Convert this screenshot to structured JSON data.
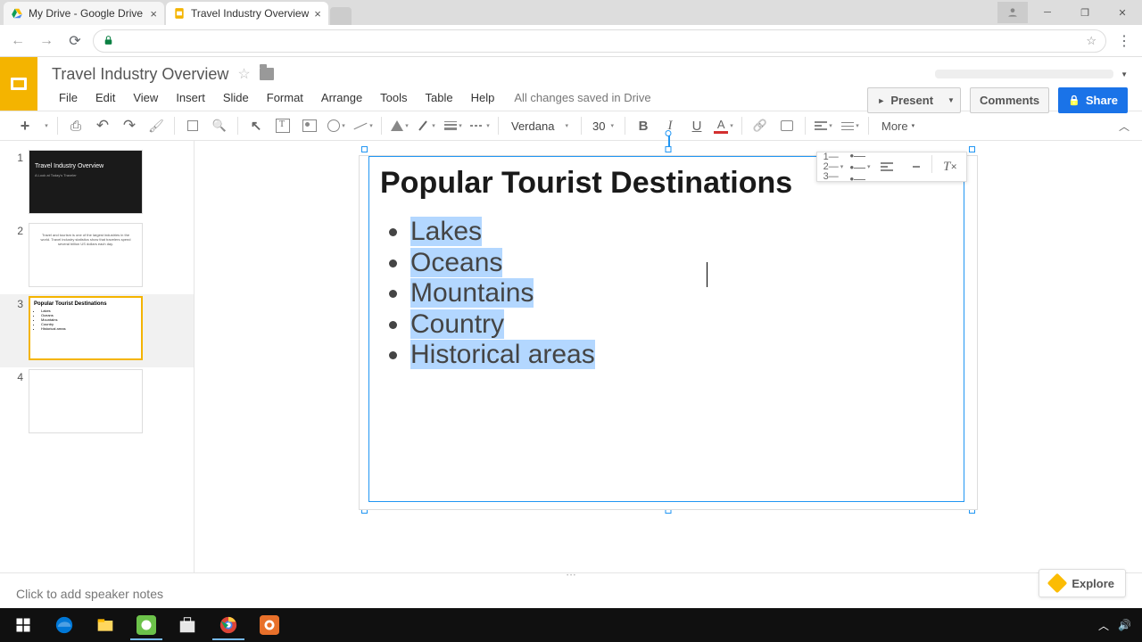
{
  "browser": {
    "tabs": [
      {
        "title": "My Drive - Google Drive",
        "active": false
      },
      {
        "title": "Travel Industry Overview",
        "active": true
      }
    ]
  },
  "doc": {
    "title": "Travel Industry Overview",
    "save_status": "All changes saved in Drive"
  },
  "menu": [
    "File",
    "Edit",
    "View",
    "Insert",
    "Slide",
    "Format",
    "Arrange",
    "Tools",
    "Table",
    "Help"
  ],
  "header_buttons": {
    "present": "Present",
    "comments": "Comments",
    "share": "Share"
  },
  "toolbar": {
    "font_name": "Verdana",
    "font_size": "30",
    "more": "More"
  },
  "thumbnails": {
    "selected": 3,
    "slides": [
      {
        "num": "1",
        "title": "Travel Industry Overview",
        "subtitle": "A Look at Today's Traveler"
      },
      {
        "num": "2",
        "body": "Travel and tourism is one of the largest industries in the world. Travel industry statistics show that travelers spend several billion US dollars each day."
      },
      {
        "num": "3",
        "title": "Popular Tourist Destinations",
        "bullets": [
          "Lakes",
          "Oceans",
          "Mountains",
          "Country",
          "Historical areas"
        ]
      },
      {
        "num": "4"
      }
    ]
  },
  "slide": {
    "title": "Popular Tourist Destinations",
    "bullets": [
      "Lakes",
      "Oceans",
      "Mountains",
      "Country",
      "Historical areas"
    ]
  },
  "notes_placeholder": "Click to add speaker notes",
  "explore": "Explore"
}
